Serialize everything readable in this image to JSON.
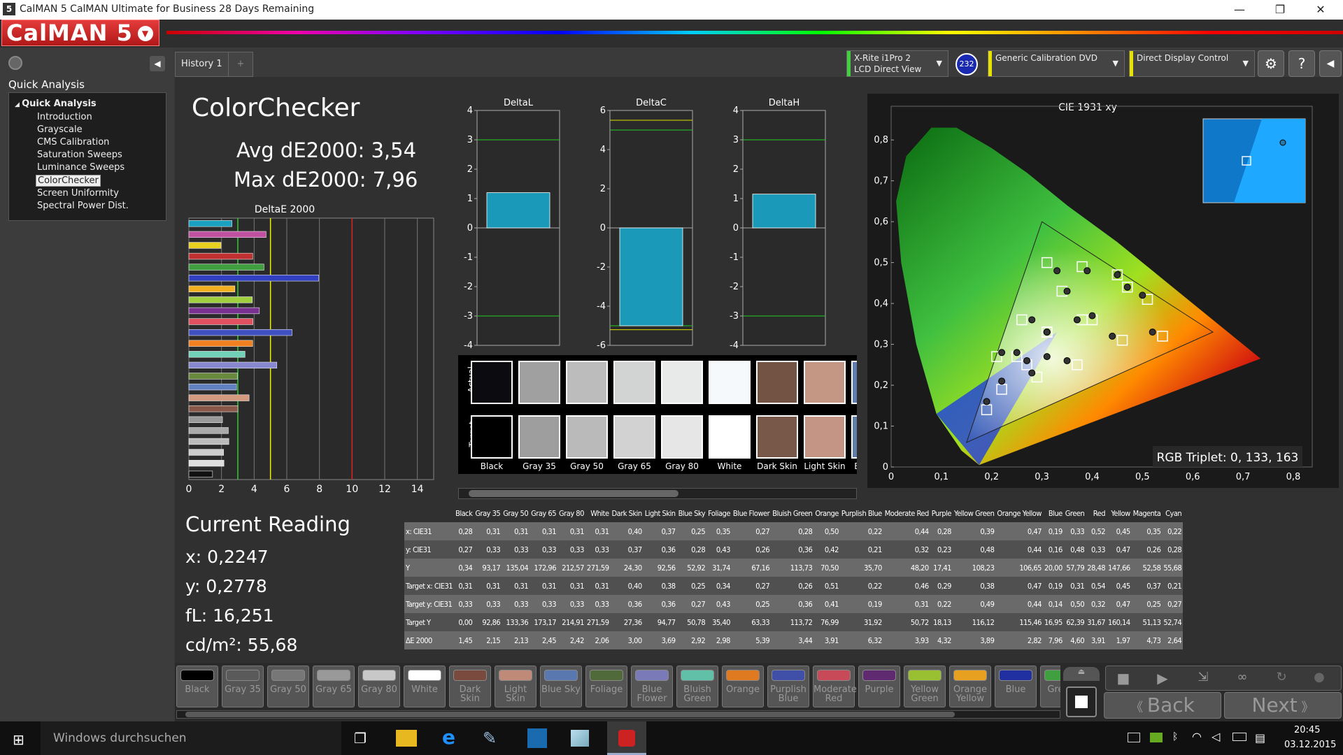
{
  "window": {
    "title": "CalMAN 5 CalMAN Ultimate for Business 28 Days Remaining",
    "app_icon": "5",
    "min": "—",
    "max": "❐",
    "close": "✕"
  },
  "logo": {
    "text": "CalMAN 5"
  },
  "sidebar": {
    "section_title": "Quick Analysis",
    "tree_root": "Quick Analysis",
    "items": [
      "Introduction",
      "Grayscale",
      "CMS Calibration",
      "Saturation Sweeps",
      "Luminance Sweeps",
      "ColorChecker",
      "Screen Uniformity",
      "Spectral Power Dist."
    ],
    "selected": "ColorChecker"
  },
  "tabs": [
    {
      "label": "History 1"
    },
    {
      "label": "+"
    }
  ],
  "devices": [
    {
      "line1": "X-Rite i1Pro 2",
      "line2": "LCD Direct View",
      "badge": "232",
      "color": "#40d040"
    },
    {
      "line1": "Generic Calibration DVD",
      "line2": "",
      "color": "#e8e200"
    },
    {
      "line1": "Direct Display Control",
      "line2": "",
      "color": "#e8e200"
    }
  ],
  "toolbar_icons": [
    "gear-icon",
    "help-icon",
    "collapse-icon"
  ],
  "main": {
    "title": "ColorChecker",
    "avg": "Avg dE2000: 3,54",
    "max": "Max dE2000: 7,96",
    "deltae_title": "DeltaE 2000",
    "current_reading_title": "Current Reading",
    "x": "x: 0,2247",
    "y": "y: 0,2778",
    "fl": "fL: 16,251",
    "cdm": "cd/m²: 55,68"
  },
  "chart_data": [
    {
      "type": "bar",
      "title": "DeltaE 2000",
      "orientation": "horizontal",
      "categories": [
        "Black",
        "Gray 35",
        "Gray 50",
        "Gray 65",
        "Gray 80",
        "White",
        "Dark Skin",
        "Light Skin",
        "Blue Sky",
        "Foliage",
        "Blue Flower",
        "Bluish Green",
        "Orange",
        "Purplish Blue",
        "Moderate Red",
        "Purple",
        "Yellow Green",
        "Orange Yellow",
        "Blue",
        "Green",
        "Red",
        "Yellow",
        "Magenta",
        "Cyan"
      ],
      "values": [
        1.45,
        2.15,
        2.13,
        2.45,
        2.42,
        2.06,
        3.0,
        3.69,
        2.92,
        2.98,
        5.39,
        3.44,
        3.91,
        6.32,
        3.93,
        4.32,
        3.89,
        2.82,
        7.96,
        4.6,
        3.91,
        1.97,
        4.73,
        2.64
      ],
      "xlim": [
        0,
        15
      ],
      "xticks": [
        "0",
        "2",
        "4",
        "6",
        "8",
        "10",
        "12",
        "14"
      ]
    },
    {
      "type": "bar",
      "title": "DeltaL",
      "values": [
        1.2
      ],
      "ylim": [
        -4,
        4
      ],
      "yticks": [
        "4",
        "3",
        "2",
        "1",
        "0",
        "-1",
        "-2",
        "-3",
        "-4"
      ]
    },
    {
      "type": "bar",
      "title": "DeltaC",
      "values": [
        -5.0
      ],
      "ylim": [
        -6,
        6
      ],
      "yticks": [
        "6",
        "4",
        "2",
        "0",
        "-2",
        "-4",
        "-6"
      ]
    },
    {
      "type": "bar",
      "title": "DeltaH",
      "values": [
        1.15
      ],
      "ylim": [
        -4,
        4
      ],
      "yticks": [
        "4",
        "3",
        "2",
        "1",
        "0",
        "-1",
        "-2",
        "-3",
        "-4"
      ]
    },
    {
      "type": "scatter",
      "title": "CIE 1931 xy",
      "xlim": [
        0,
        0.8
      ],
      "ylim": [
        0,
        0.9
      ],
      "xticks": [
        "0",
        "0,1",
        "0,2",
        "0,3",
        "0,4",
        "0,5",
        "0,6",
        "0,7",
        "0,8"
      ],
      "yticks": [
        "0",
        "0,1",
        "0,2",
        "0,3",
        "0,4",
        "0,5",
        "0,6",
        "0,7",
        "0,8"
      ],
      "actual_x": [
        0.31,
        0.31,
        0.31,
        0.31,
        0.31,
        0.31,
        0.4,
        0.37,
        0.25,
        0.35,
        0.27,
        0.28,
        0.5,
        0.22,
        0.44,
        0.28,
        0.39,
        0.47,
        0.19,
        0.33,
        0.52,
        0.45,
        0.35,
        0.22
      ],
      "actual_y": [
        0.27,
        0.33,
        0.33,
        0.33,
        0.33,
        0.33,
        0.37,
        0.36,
        0.28,
        0.43,
        0.26,
        0.36,
        0.42,
        0.21,
        0.32,
        0.23,
        0.48,
        0.44,
        0.16,
        0.48,
        0.33,
        0.47,
        0.26,
        0.28
      ],
      "target_x": [
        0.31,
        0.31,
        0.31,
        0.31,
        0.31,
        0.31,
        0.4,
        0.38,
        0.25,
        0.34,
        0.27,
        0.26,
        0.51,
        0.22,
        0.46,
        0.29,
        0.38,
        0.47,
        0.19,
        0.31,
        0.54,
        0.45,
        0.37,
        0.21
      ],
      "target_y": [
        0.33,
        0.33,
        0.33,
        0.33,
        0.33,
        0.33,
        0.36,
        0.36,
        0.27,
        0.43,
        0.25,
        0.36,
        0.41,
        0.19,
        0.31,
        0.22,
        0.49,
        0.44,
        0.14,
        0.5,
        0.32,
        0.47,
        0.25,
        0.27
      ],
      "rgb_triplet": "RGB Triplet: 0, 133, 163"
    }
  ],
  "swatches": {
    "row_actual": "Actual",
    "row_target": "Target",
    "items": [
      {
        "label": "Black",
        "actual": "#0c0c10",
        "target": "#000000"
      },
      {
        "label": "Gray 35",
        "actual": "#a0a0a0",
        "target": "#9e9e9e"
      },
      {
        "label": "Gray 50",
        "actual": "#bcbcbc",
        "target": "#bababa"
      },
      {
        "label": "Gray 65",
        "actual": "#d2d4d4",
        "target": "#d2d2d2"
      },
      {
        "label": "Gray 80",
        "actual": "#e8eaea",
        "target": "#e6e6e6"
      },
      {
        "label": "White",
        "actual": "#f6f9fc",
        "target": "#ffffff"
      },
      {
        "label": "Dark Skin",
        "actual": "#735444",
        "target": "#785848"
      },
      {
        "label": "Light Skin",
        "actual": "#c49784",
        "target": "#c49585"
      },
      {
        "label": "Blue Sky",
        "actual": "#5f7eb0",
        "target": "#5f7ea8"
      }
    ]
  },
  "table": {
    "columns": [
      "Black",
      "Gray 35",
      "Gray 50",
      "Gray 65",
      "Gray 80",
      "White",
      "Dark Skin",
      "Light Skin",
      "Blue Sky",
      "Foliage",
      "Blue Flower",
      "Bluish Green",
      "Orange",
      "Purplish Blue",
      "Moderate Red",
      "Purple",
      "Yellow Green",
      "Orange Yellow",
      "Blue",
      "Green",
      "Red",
      "Yellow",
      "Magenta",
      "Cyan"
    ],
    "rows": [
      {
        "label": "x: CIE31",
        "values": [
          "0,28",
          "0,31",
          "0,31",
          "0,31",
          "0,31",
          "0,31",
          "0,40",
          "0,37",
          "0,25",
          "0,35",
          "0,27",
          "0,28",
          "0,50",
          "0,22",
          "0,44",
          "0,28",
          "0,39",
          "0,47",
          "0,19",
          "0,33",
          "0,52",
          "0,45",
          "0,35",
          "0,22"
        ]
      },
      {
        "label": "y: CIE31",
        "values": [
          "0,27",
          "0,33",
          "0,33",
          "0,33",
          "0,33",
          "0,33",
          "0,37",
          "0,36",
          "0,28",
          "0,43",
          "0,26",
          "0,36",
          "0,42",
          "0,21",
          "0,32",
          "0,23",
          "0,48",
          "0,44",
          "0,16",
          "0,48",
          "0,33",
          "0,47",
          "0,26",
          "0,28"
        ]
      },
      {
        "label": "Y",
        "values": [
          "0,34",
          "93,17",
          "135,04",
          "172,96",
          "212,57",
          "271,59",
          "24,30",
          "92,56",
          "52,92",
          "31,74",
          "67,16",
          "113,73",
          "70,50",
          "35,70",
          "48,20",
          "17,41",
          "108,23",
          "106,65",
          "20,00",
          "57,79",
          "28,48",
          "147,66",
          "52,58",
          "55,68"
        ]
      },
      {
        "label": "Target x: CIE31",
        "values": [
          "0,31",
          "0,31",
          "0,31",
          "0,31",
          "0,31",
          "0,31",
          "0,40",
          "0,38",
          "0,25",
          "0,34",
          "0,27",
          "0,26",
          "0,51",
          "0,22",
          "0,46",
          "0,29",
          "0,38",
          "0,47",
          "0,19",
          "0,31",
          "0,54",
          "0,45",
          "0,37",
          "0,21"
        ]
      },
      {
        "label": "Target y: CIE31",
        "values": [
          "0,33",
          "0,33",
          "0,33",
          "0,33",
          "0,33",
          "0,33",
          "0,36",
          "0,36",
          "0,27",
          "0,43",
          "0,25",
          "0,36",
          "0,41",
          "0,19",
          "0,31",
          "0,22",
          "0,49",
          "0,44",
          "0,14",
          "0,50",
          "0,32",
          "0,47",
          "0,25",
          "0,27"
        ]
      },
      {
        "label": "Target Y",
        "values": [
          "0,00",
          "92,86",
          "133,36",
          "173,17",
          "214,91",
          "271,59",
          "27,36",
          "94,77",
          "50,78",
          "35,40",
          "63,33",
          "113,72",
          "76,99",
          "31,92",
          "50,72",
          "18,13",
          "116,12",
          "115,46",
          "16,95",
          "62,39",
          "31,67",
          "160,14",
          "51,13",
          "52,74"
        ]
      },
      {
        "label": "ΔE 2000",
        "values": [
          "1,45",
          "2,15",
          "2,13",
          "2,45",
          "2,42",
          "2,06",
          "3,00",
          "3,69",
          "2,92",
          "2,98",
          "5,39",
          "3,44",
          "3,91",
          "6,32",
          "3,93",
          "4,32",
          "3,89",
          "2,82",
          "7,96",
          "4,60",
          "3,91",
          "1,97",
          "4,73",
          "2,64"
        ]
      }
    ]
  },
  "patches": [
    {
      "label": "Black",
      "color": "#000000"
    },
    {
      "label": "Gray 35",
      "color": "#5a5a5a"
    },
    {
      "label": "Gray 50",
      "color": "#777777"
    },
    {
      "label": "Gray 65",
      "color": "#999999"
    },
    {
      "label": "Gray 80",
      "color": "#c8c8c8"
    },
    {
      "label": "White",
      "color": "#ffffff"
    },
    {
      "label": "Dark Skin",
      "color": "#7a4a3e"
    },
    {
      "label": "Light Skin",
      "color": "#c08a78"
    },
    {
      "label": "Blue Sky",
      "color": "#5a78b0"
    },
    {
      "label": "Foliage",
      "color": "#506a3a"
    },
    {
      "label": "Blue Flower",
      "color": "#7a7ab8"
    },
    {
      "label": "Bluish Green",
      "color": "#60c0a8"
    },
    {
      "label": "Orange",
      "color": "#e07a20"
    },
    {
      "label": "Purplish Blue",
      "color": "#4050a8"
    },
    {
      "label": "Moderate Red",
      "color": "#c84a58"
    },
    {
      "label": "Purple",
      "color": "#602a70"
    },
    {
      "label": "Yellow Green",
      "color": "#98c030"
    },
    {
      "label": "Orange Yellow",
      "color": "#e8a020"
    },
    {
      "label": "Blue",
      "color": "#2030a0"
    },
    {
      "label": "Green",
      "color": "#40a040"
    }
  ],
  "nav": {
    "back": "Back",
    "next": "Next"
  },
  "taskbar": {
    "search": "Windows durchsuchen",
    "time": "20:45",
    "date": "03.12.2015"
  }
}
